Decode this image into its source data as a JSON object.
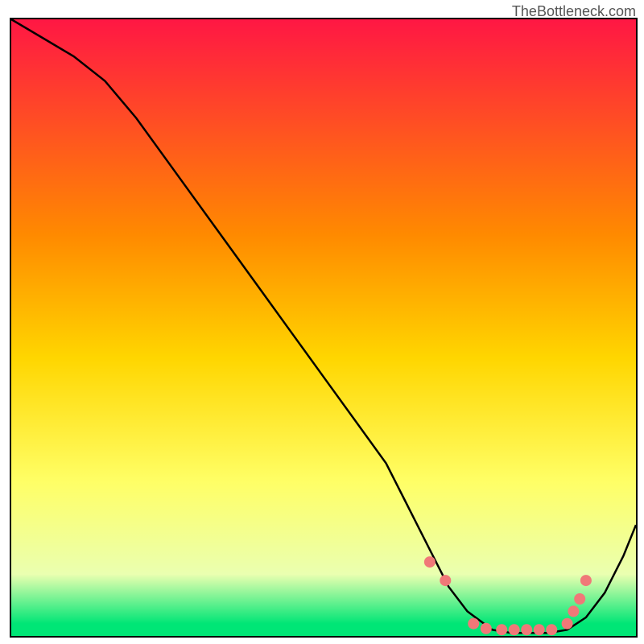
{
  "watermark": "TheBottleneck.com",
  "chart_data": {
    "type": "line",
    "title": "",
    "xlabel": "",
    "ylabel": "",
    "xlim": [
      0,
      100
    ],
    "ylim": [
      0,
      100
    ],
    "gradient_background": {
      "stops": [
        {
          "offset": 0,
          "color": "#ff1744"
        },
        {
          "offset": 35,
          "color": "#ff8a00"
        },
        {
          "offset": 55,
          "color": "#ffd600"
        },
        {
          "offset": 75,
          "color": "#ffff66"
        },
        {
          "offset": 90,
          "color": "#eaffb0"
        },
        {
          "offset": 98,
          "color": "#00e676"
        }
      ]
    },
    "series": [
      {
        "name": "bottleneck-curve",
        "type": "line",
        "color": "#000000",
        "x": [
          0,
          5,
          10,
          15,
          20,
          25,
          30,
          35,
          40,
          45,
          50,
          55,
          60,
          63,
          67,
          70,
          73,
          77,
          80,
          83,
          86,
          89,
          92,
          95,
          98,
          100
        ],
        "y": [
          100,
          97,
          94,
          90,
          84,
          77,
          70,
          63,
          56,
          49,
          42,
          35,
          28,
          22,
          14,
          8,
          4,
          1,
          0.5,
          0.5,
          0.5,
          1,
          3,
          7,
          13,
          18
        ]
      }
    ],
    "markers": {
      "name": "highlight-dots",
      "color": "#f07878",
      "radius": 7,
      "x": [
        67,
        69.5,
        74,
        76,
        78.5,
        80.5,
        82.5,
        84.5,
        86.5,
        89,
        90,
        91,
        92
      ],
      "y": [
        12,
        9,
        2,
        1.2,
        1,
        1,
        1,
        1,
        1,
        2,
        4,
        6,
        9
      ]
    }
  }
}
